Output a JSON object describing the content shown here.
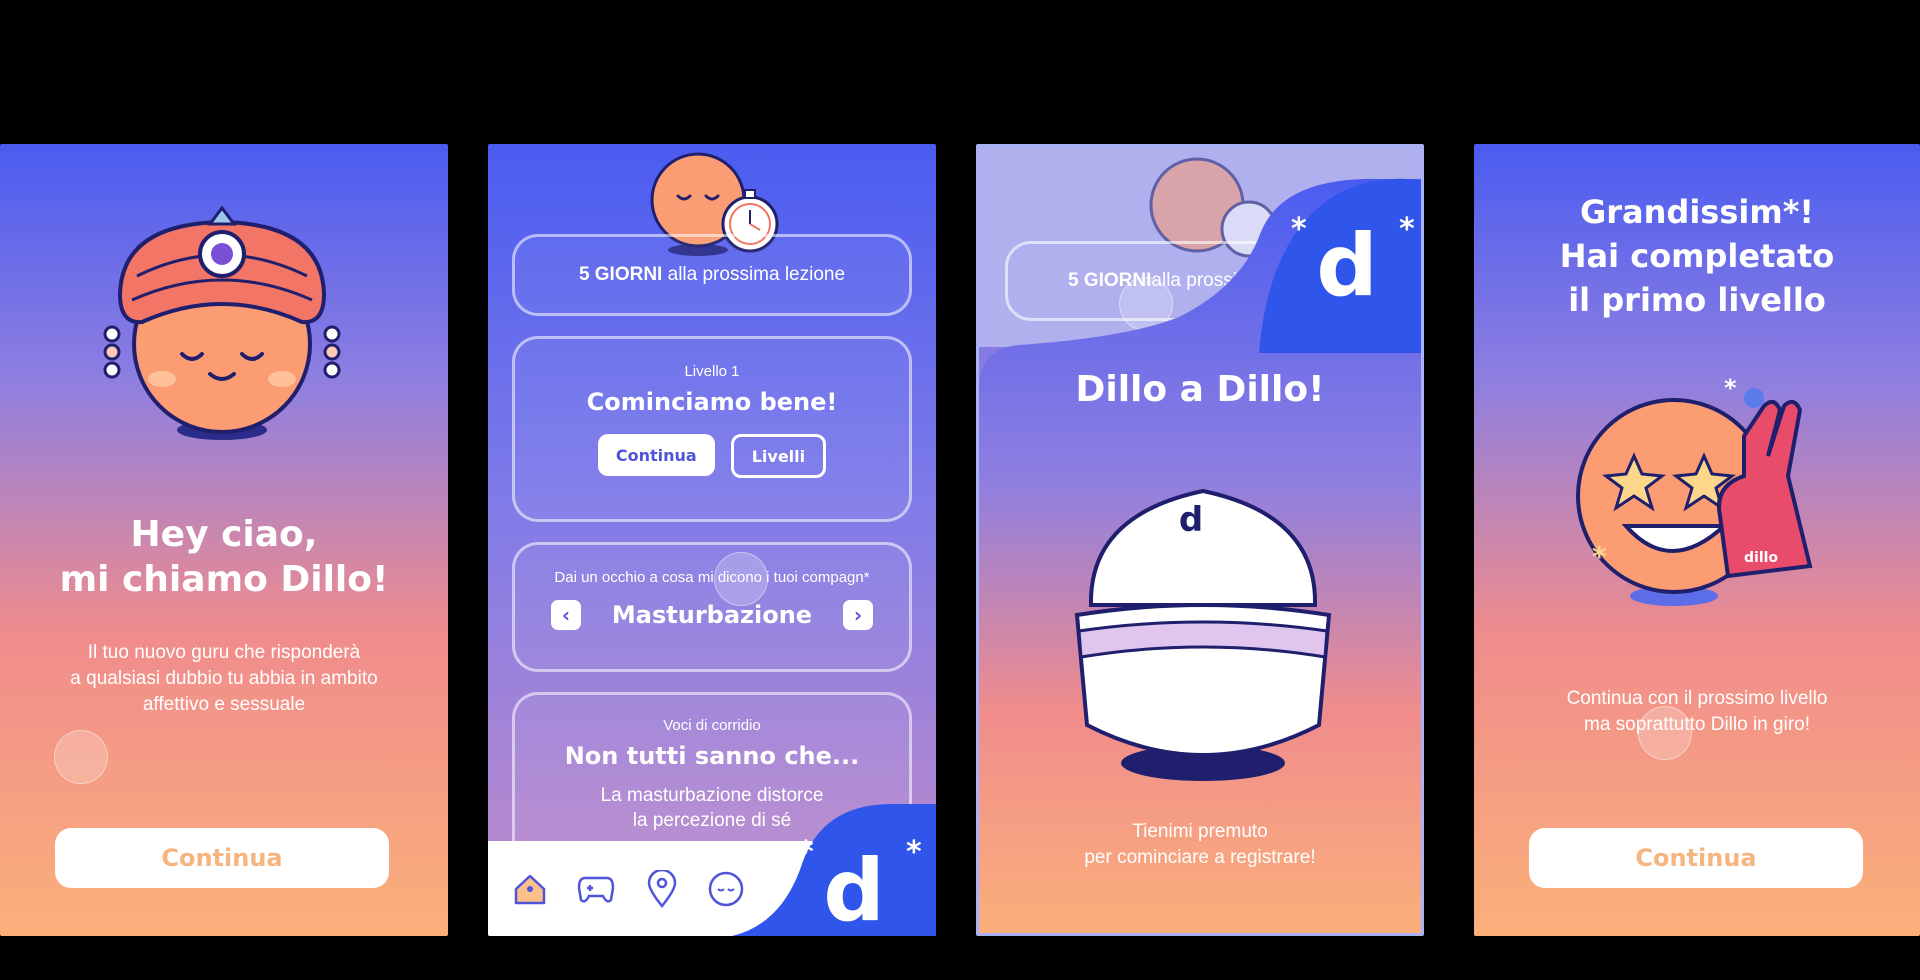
{
  "screen1": {
    "headline_1": "Hey ciao,",
    "headline_2": "mi chiamo Dillo!",
    "body_1": "Il tuo nuovo guru che risponderà",
    "body_2": "a qualsiasi dubbio tu abbia in ambito",
    "body_3": "affettivo e sessuale",
    "button": "Continua"
  },
  "screen2": {
    "countdown_bold": "5 GIORNI",
    "countdown_rest": " alla prossima lezione",
    "level_label": "Livello 1",
    "level_title": "Cominciamo bene!",
    "btn_continue": "Continua",
    "btn_levels": "Livelli",
    "peek_label": "Dai un occhio a cosa mi dicono i tuoi compagn*",
    "peek_topic": "Masturbazione",
    "rumors_label": "Voci di corridio",
    "rumors_title": "Non tutti sanno che...",
    "rumors_text_1": "La masturbazione distorce",
    "rumors_text_2": "la percezione di sé",
    "nav": [
      "home-icon",
      "gamepad-icon",
      "map-pin-icon",
      "avatar-face-icon"
    ],
    "logo": "d"
  },
  "screen3": {
    "countdown_bold": "5 GIORNI",
    "countdown_rest": " alla prossi",
    "headline": "Dillo a Dillo!",
    "device_logo": "d",
    "body_1": "Tienimi premuto",
    "body_2": "per cominciare a registrare!",
    "logo": "d"
  },
  "screen4": {
    "headline_1": "Grandissim*!",
    "headline_2": "Hai completato",
    "headline_3": "il primo livello",
    "foam_text": "dillo",
    "body_1": "Continua con il prossimo livello",
    "body_2": "ma soprattutto Dillo in giro!",
    "button": "Continua"
  },
  "colors": {
    "gradient_top": "#4a5cf0",
    "gradient_mid": "#8f7fe0",
    "gradient_pink": "#f08c8c",
    "gradient_bottom": "#fbb07a",
    "brand_blue": "#2f55ea",
    "face": "#fb9c72",
    "turban": "#f27565",
    "navy": "#1f1f6e",
    "button_text": "#f6b47f"
  }
}
